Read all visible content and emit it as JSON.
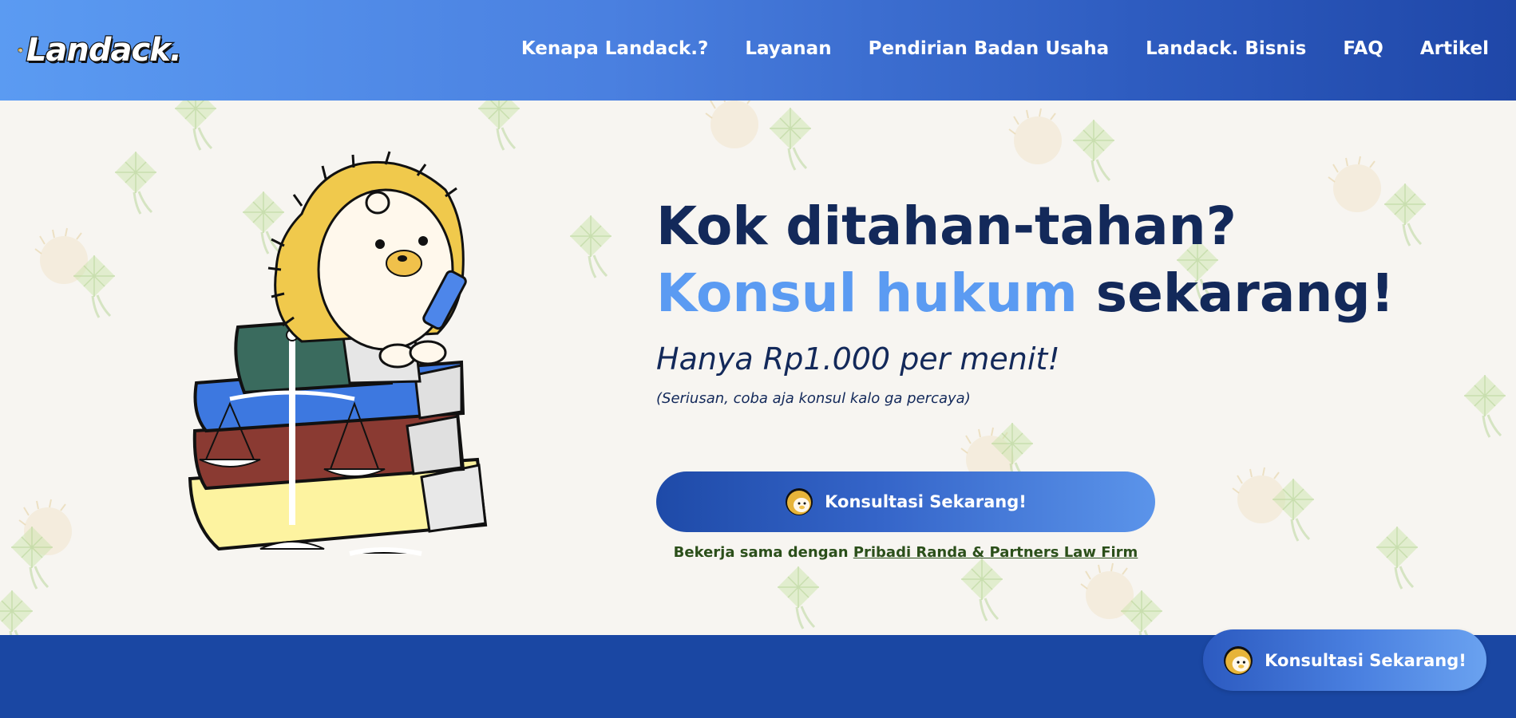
{
  "brand": {
    "logo_text": "Landack."
  },
  "nav": {
    "items": [
      {
        "label": "Kenapa Landack.?"
      },
      {
        "label": "Layanan"
      },
      {
        "label": "Pendirian Badan Usaha"
      },
      {
        "label": "Landack. Bisnis"
      },
      {
        "label": "FAQ"
      },
      {
        "label": "Artikel"
      }
    ]
  },
  "hero": {
    "headline_line1": "Kok ditahan-tahan?",
    "headline_accent": "Konsul hukum",
    "headline_rest": " sekarang!",
    "price": "Hanya Rp1.000 per menit!",
    "note": "(Seriusan, coba aja konsul kalo ga percaya)",
    "cta_label": "Konsultasi Sekarang!",
    "partner_prefix": "Bekerja sama dengan ",
    "partner_link": "Pribadi Randa & Partners Law Firm"
  },
  "floating": {
    "cta_label": "Konsultasi Sekarang!"
  },
  "colors": {
    "navy": "#13295a",
    "accent_blue": "#5b9bf2",
    "brand_blue": "#1a47a3",
    "partner_green": "#2b4f1a",
    "background": "#f7f5f1"
  },
  "icons": {
    "logo": "hedgehog-mascot-icon",
    "cta": "hedgehog-avatar-icon",
    "illustration": "hedgehog-on-law-books-illustration"
  }
}
